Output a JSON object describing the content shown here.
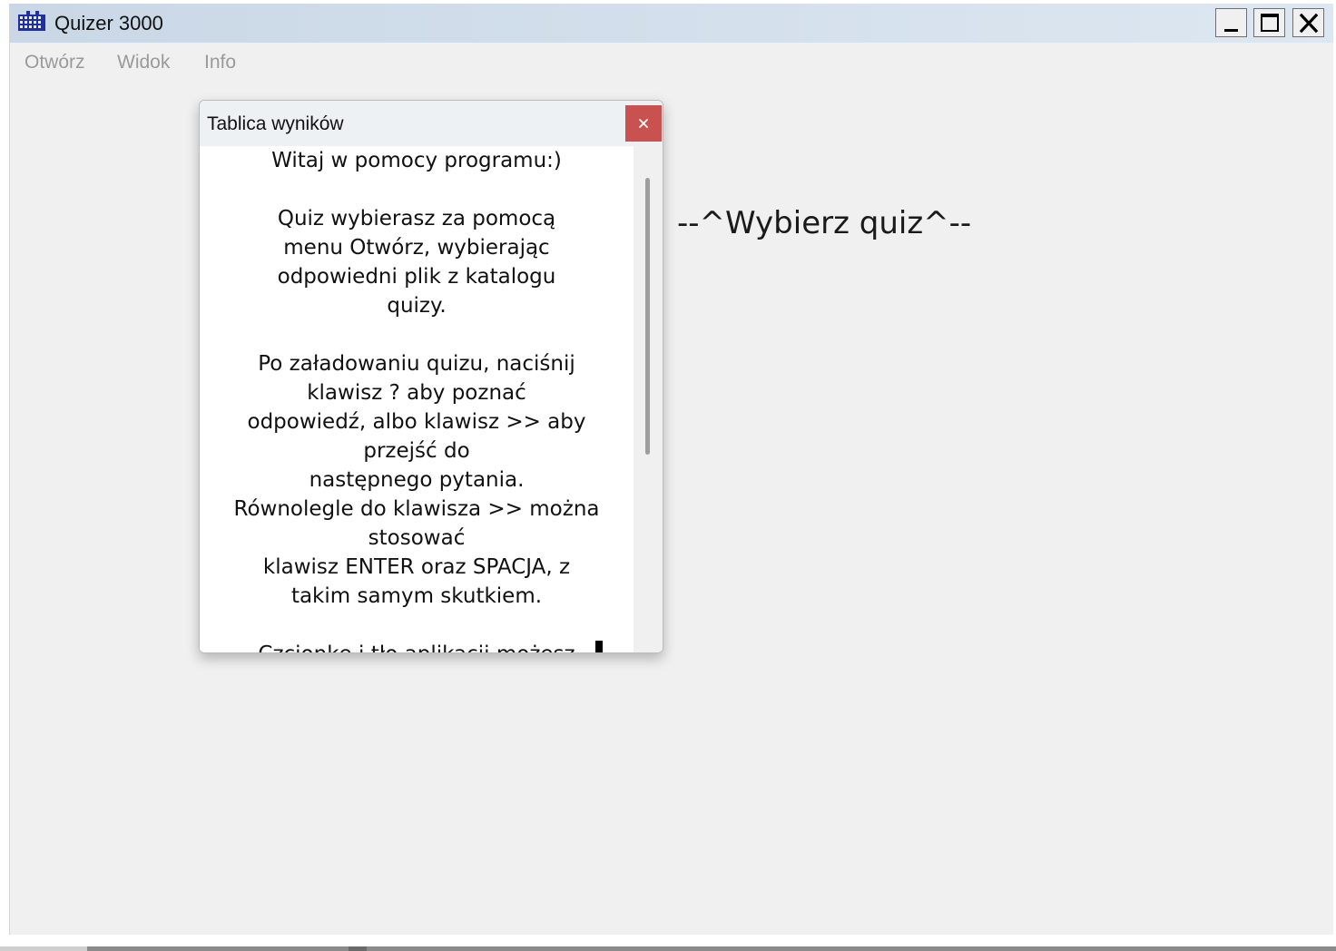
{
  "window": {
    "title": "Quizer 3000"
  },
  "menu": {
    "items": [
      "Otwórz",
      "Widok",
      "Info"
    ]
  },
  "dialog": {
    "title": "Tablica wyników",
    "close_label": "×",
    "content": "Witaj w pomocy programu:)\n\nQuiz wybierasz za pomocą\nmenu Otwórz, wybierając\nodpowiedni plik z katalogu\nquizy.\n\nPo załadowaniu quizu, naciśnij\nklawisz ? aby poznać\nodpowiedź, albo klawisz >> aby\nprzejść do\nnastępnego pytania.\nRównolegle do klawisza >> można\nstosować\nklawisz ENTER oraz SPACJA, z\ntakim samym skutkiem.\n\nCzcionkę i tło aplikacji możesz"
  },
  "main": {
    "prompt": "--^Wybierz quiz^--"
  },
  "colors": {
    "titlebar": "#c9d7e6",
    "window_bg": "#f0f0f0",
    "menu_disabled": "#9a9a9a",
    "dialog_close": "#c9514f"
  }
}
